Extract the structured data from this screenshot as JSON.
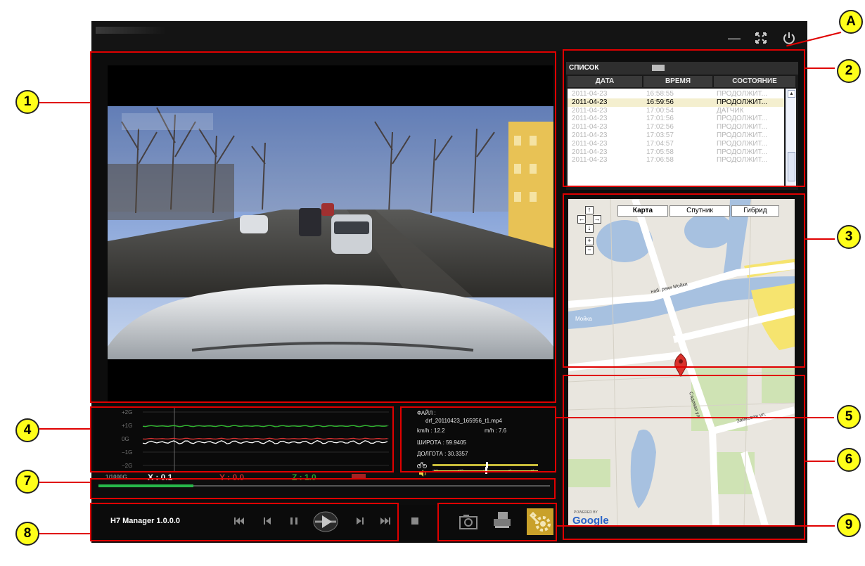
{
  "window": {
    "minimize_icon": "minus-icon",
    "maximize_icon": "fullscreen-icon",
    "power_icon": "power-icon"
  },
  "list": {
    "header": "СПИСОК",
    "columns": [
      "ДАТА",
      "ВРЕМЯ",
      "СОСТОЯНИЕ"
    ],
    "rows": [
      [
        "2011-04-23",
        "16:58:55",
        "ПРОДОЛЖИТ..."
      ],
      [
        "2011-04-23",
        "16:59:56",
        "ПРОДОЛЖИТ..."
      ],
      [
        "2011-04-23",
        "17:00:54",
        "ДАТЧИК"
      ],
      [
        "2011-04-23",
        "17:01:56",
        "ПРОДОЛЖИТ..."
      ],
      [
        "2011-04-23",
        "17:02:56",
        "ПРОДОЛЖИТ..."
      ],
      [
        "2011-04-23",
        "17:03:57",
        "ПРОДОЛЖИТ..."
      ],
      [
        "2011-04-23",
        "17:04:57",
        "ПРОДОЛЖИТ..."
      ],
      [
        "2011-04-23",
        "17:05:58",
        "ПРОДОЛЖИТ..."
      ],
      [
        "2011-04-23",
        "17:06:58",
        "ПРОДОЛЖИТ..."
      ]
    ],
    "selected_index": 1
  },
  "map": {
    "tabs": [
      "Карта",
      "Спутник",
      "Гибрид"
    ],
    "active_tab": 0,
    "street_labels": [
      "наб. реки Мойки",
      "Мойка",
      "Садовая ул.",
      "Замковая ул."
    ],
    "powered_by": "POWERED BY",
    "brand": "Google"
  },
  "graph": {
    "ticks": [
      "+2G",
      "+1G",
      "0G",
      "−1G",
      "−2G"
    ]
  },
  "info": {
    "file_label": "ФАЙЛ :",
    "file_name": "drf_20110423_165956_t1.mp4",
    "kmh": "km/h : 12.2",
    "mph": "m/h : 7.6",
    "latitude": "ШИРОТА : 59.9405",
    "longitude": "ДОЛГОТА : 30.3357",
    "speed_ticks": [
      "x1/4",
      "x1/2",
      "x1",
      "x2",
      "x4"
    ]
  },
  "axes": {
    "scale": "1/1000G",
    "x": "X : 0.1",
    "y": "Y : 0.0",
    "z": "Z : 1.0"
  },
  "playback": {
    "progress": 0.21
  },
  "app": {
    "name": "H7 Manager 1.0.0.0"
  },
  "callouts": [
    "A",
    "1",
    "2",
    "3",
    "4",
    "5",
    "6",
    "7",
    "8",
    "9"
  ],
  "colors": {
    "annotation": "#e00000",
    "callout_fill": "#ffff1a",
    "progress": "#27b84a",
    "graph_x": "#2fb82f",
    "graph_y": "#d83030",
    "graph_z": "#ffffff"
  }
}
